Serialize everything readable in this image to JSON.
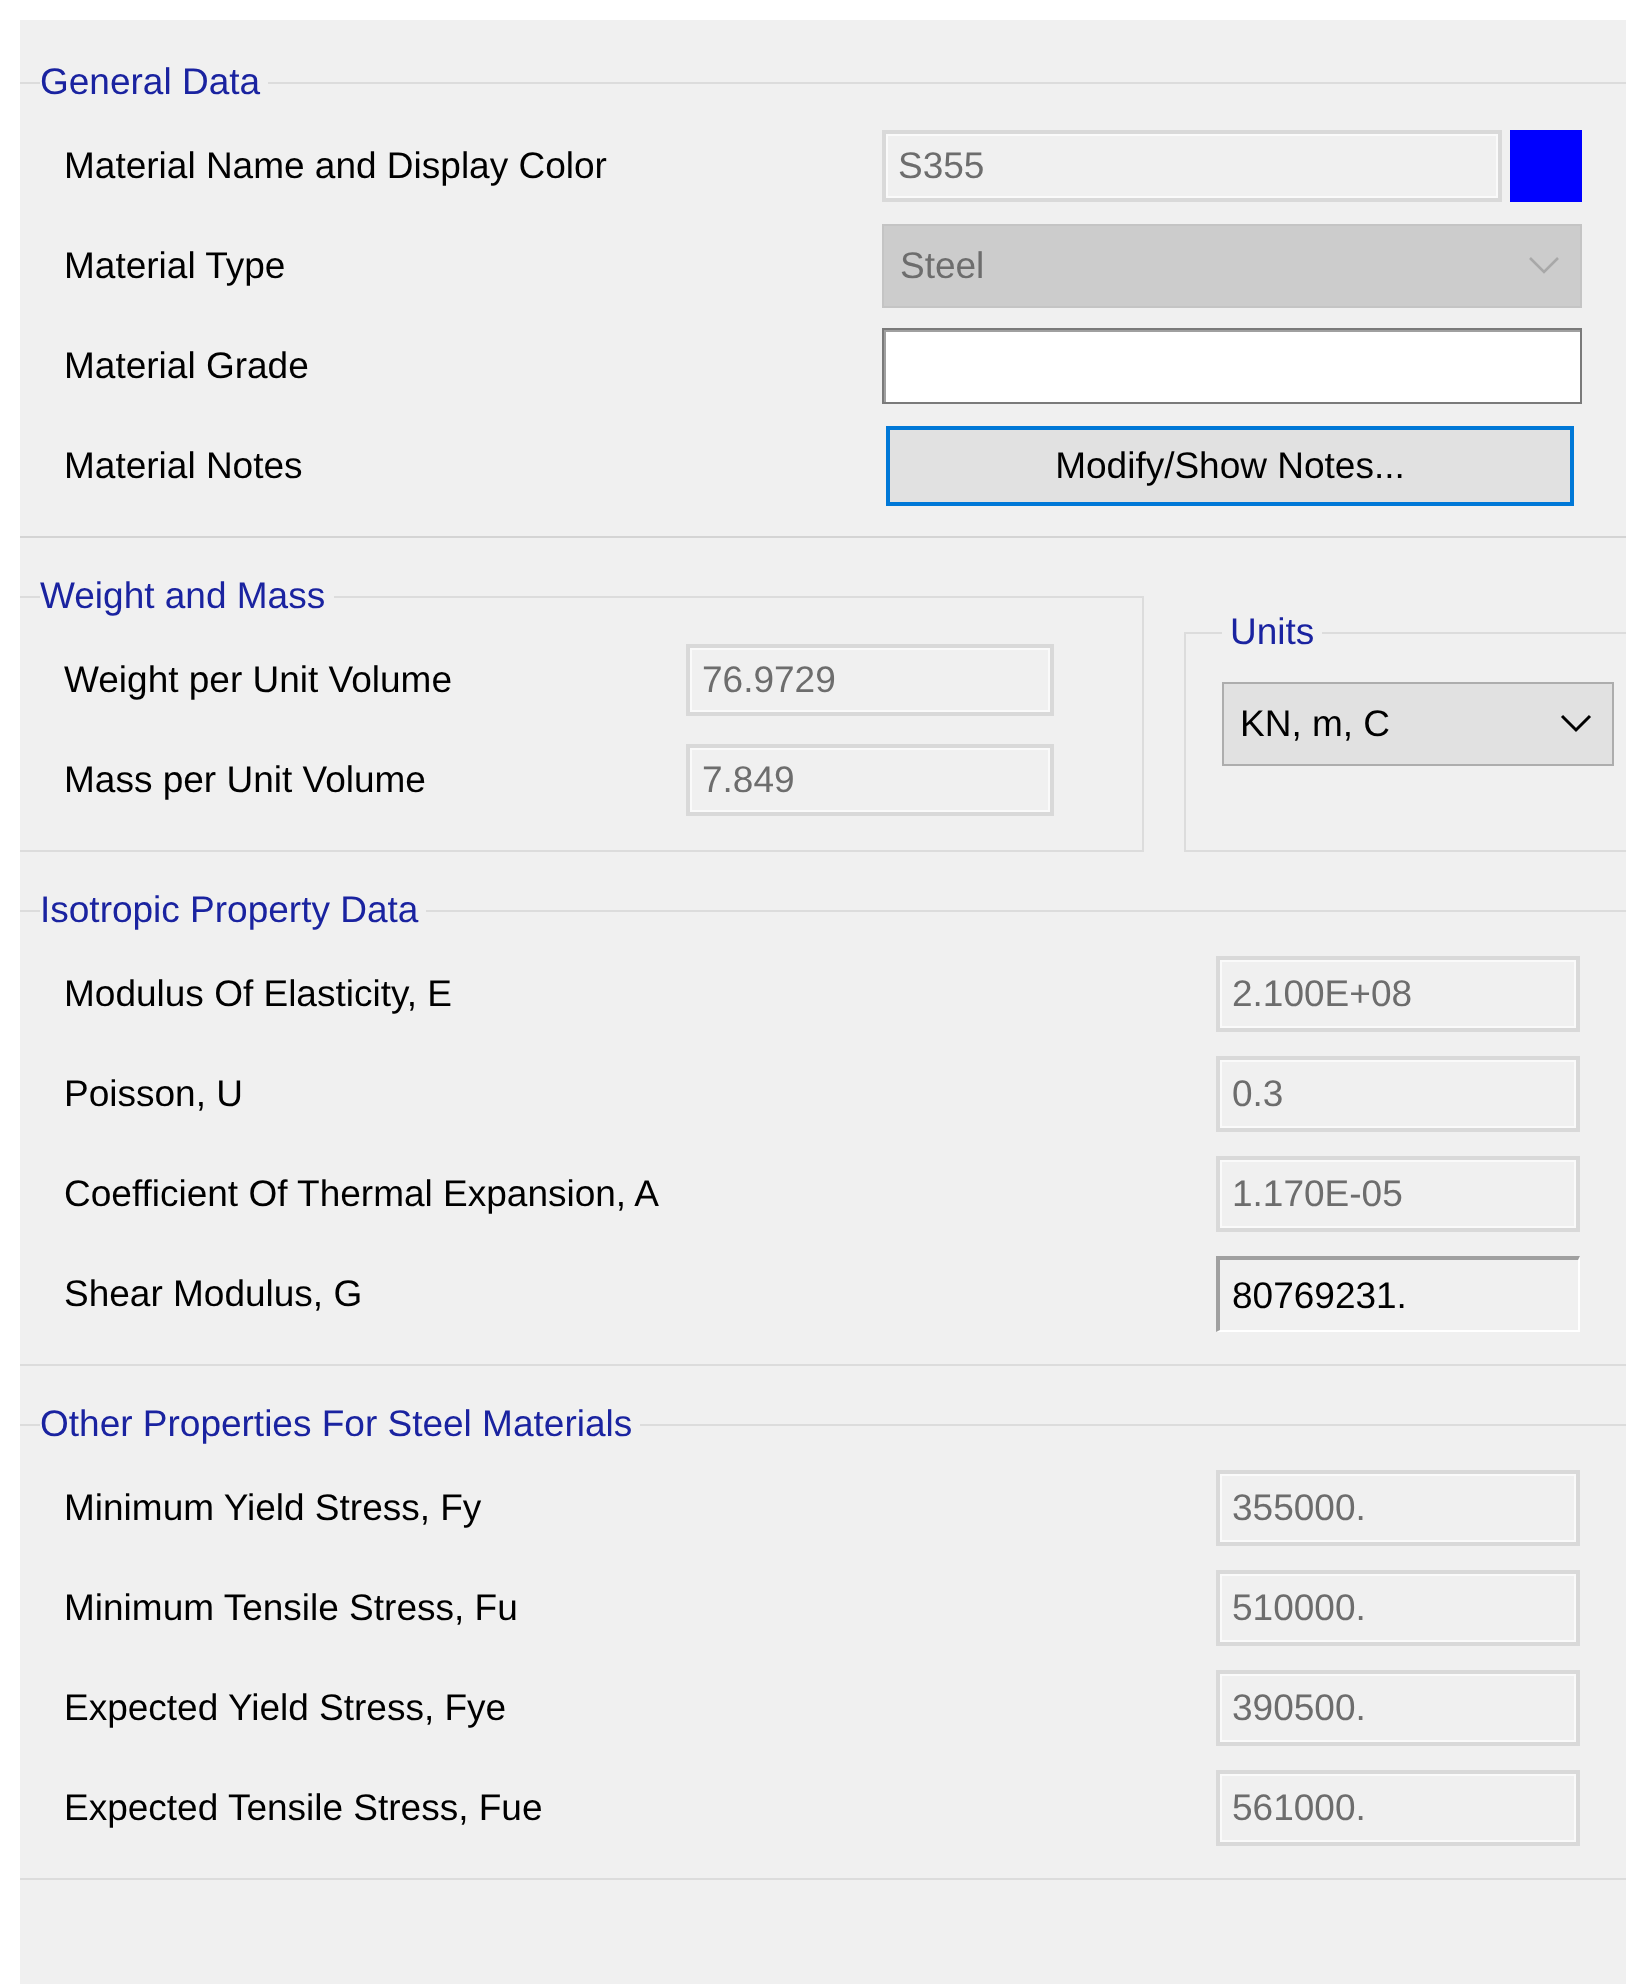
{
  "general": {
    "title": "General Data",
    "rows": [
      {
        "label": "Material Name and Display Color",
        "kind": "text_color",
        "value": "S355",
        "disabled": true,
        "color": "#0000ff"
      },
      {
        "label": "Material Type",
        "kind": "dropdown",
        "value": "Steel",
        "disabled": true
      },
      {
        "label": "Material Grade",
        "kind": "text",
        "disabled": false
      },
      {
        "label": "Material Notes",
        "kind": "button",
        "value": "Modify/Show Notes...",
        "focused": true
      }
    ]
  },
  "weight_and_mass": {
    "title": "Weight and Mass",
    "rows": [
      {
        "label": "Weight per Unit Volume",
        "value": "76.9729",
        "disabled": true
      },
      {
        "label": "Mass per Unit Volume",
        "value": "7.849",
        "disabled": true
      }
    ]
  },
  "units": {
    "title": "Units",
    "value": "KN, m, C"
  },
  "isotropic": {
    "title": "Isotropic Property Data",
    "rows": [
      {
        "label": "Modulus Of Elasticity,  E",
        "value": "2.100E+08",
        "disabled": true
      },
      {
        "label": "Poisson, U",
        "value": "0.3",
        "disabled": true
      },
      {
        "label": "Coefficient Of Thermal Expansion,  A",
        "value": "1.170E-05",
        "disabled": true
      },
      {
        "label": "Shear Modulus,  G",
        "value": "80769231.",
        "disabled": false
      }
    ]
  },
  "steel": {
    "title": "Other Properties For Steel Materials",
    "rows": [
      {
        "label": "Minimum Yield Stress, Fy",
        "value": "355000.",
        "disabled": true
      },
      {
        "label": "Minimum Tensile Stress, Fu",
        "value": "510000.",
        "disabled": true
      },
      {
        "label": "Expected Yield Stress, Fye",
        "value": "390500.",
        "disabled": true
      },
      {
        "label": "Expected Tensile Stress, Fue",
        "value": "561000.",
        "disabled": true
      }
    ]
  }
}
